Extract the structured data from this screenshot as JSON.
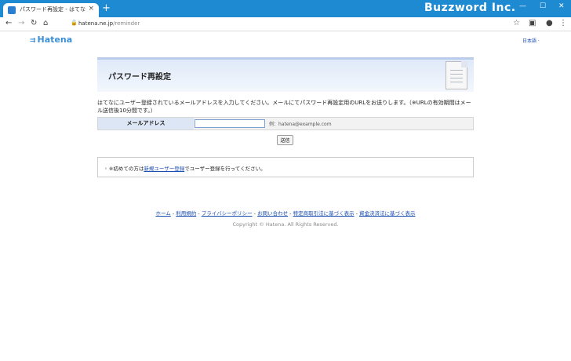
{
  "browser": {
    "tab_title": "パスワード再設定 - はてな",
    "tab_close": "×",
    "new_tab": "+",
    "brand": "Buzzword Inc.",
    "url_host": "hatena.ne.jp",
    "url_path": "/reminder",
    "accent": "#1e8ad1"
  },
  "header": {
    "logo_mark": "⇉",
    "logo_text": "Hatena",
    "lang": "日本語 ·"
  },
  "banner": {
    "title": "パスワード再設定"
  },
  "description": "はてなにユーザー登録されているメールアドレスを入力してください。メールにてパスワード再設定用のURLをお送りします。（※URLの有効期間はメール送信後10分間です。）",
  "form": {
    "label": "メールアドレス",
    "value": "",
    "example": "例：hatena@example.com",
    "submit": "送信"
  },
  "notice": {
    "prefix": "※初めての方は",
    "link": "新規ユーザー登録",
    "suffix": "でユーザー登録を行ってください。"
  },
  "footer": {
    "links": [
      "ホーム",
      "利用規約",
      "プライバシーポリシー",
      "お問い合わせ",
      "特定商取引法に基づく表示",
      "資金決済法に基づく表示"
    ],
    "separator": " - ",
    "copyright": "Copyright © Hatena. All Rights Reserved."
  }
}
